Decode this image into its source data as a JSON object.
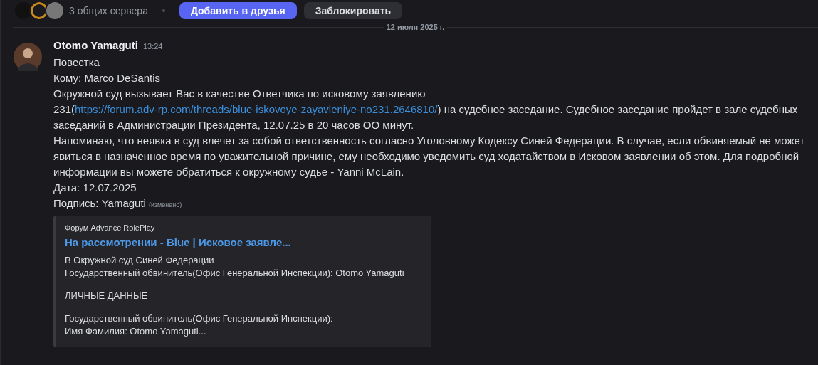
{
  "profile_bar": {
    "mutual_servers": "3 общих сервера",
    "buttons": [
      {
        "label": "Добавить в друзья",
        "kind": "primary"
      },
      {
        "label": "Заблокировать",
        "kind": "secondary"
      }
    ]
  },
  "date_divider": "12 июля 2025 г.",
  "message": {
    "author": "Otomo Yamaguti",
    "time": "13:24",
    "paragraphs": [
      [
        {
          "kind": "text",
          "text": "Повестка"
        }
      ],
      [
        {
          "kind": "text",
          "text": "Кому: Marco DeSantis"
        }
      ],
      [
        {
          "kind": "text",
          "text": "Окружной суд вызывает Вас в качестве Ответчика по исковому заявлению 231("
        },
        {
          "kind": "link",
          "text": "https://forum.adv-rp.com/threads/blue-iskovoye-zayavleniye-no231.2646810/"
        },
        {
          "kind": "text",
          "text": ")  на судебное заседание. Судебное заседание пройдет в зале судебных заседаний в Администрации Президента, 12.07.25 в 20 часов ОО минут."
        }
      ],
      [
        {
          "kind": "text",
          "text": "Напоминаю, что неявка в суд влечет за собой ответственность согласно Уголовному Кодексу Синей Федерации. В случае, если обвиняемый не может явиться в назначенное время по уважительной причине, ему необходимо уведомить суд ходатайством в Исковом заявлении об этом. Для подробной информации вы можете обратиться к окружному судье - Yanni McLain."
        }
      ],
      [
        {
          "kind": "text",
          "text": "Дата: 12.07.2025"
        }
      ],
      [
        {
          "kind": "text",
          "text": "Подпись: Yamaguti"
        }
      ]
    ],
    "edited": "(изменено)",
    "embed": {
      "provider": "Форум Advance RolePlay",
      "title": "На рассмотрении - Blue | Исковое заявле...",
      "description": [
        [
          "В Окружной суд Синей Федерации",
          "Государственный обвинитель(Офис Генеральной Инспекции): Otomo Yamaguti"
        ],
        [
          "ЛИЧНЫЕ ДАННЫЕ"
        ],
        [
          "Государственный обвинитель(Офис Генеральной Инспекции):",
          "Имя Фамилия: Otomo Yamaguti..."
        ]
      ]
    }
  }
}
